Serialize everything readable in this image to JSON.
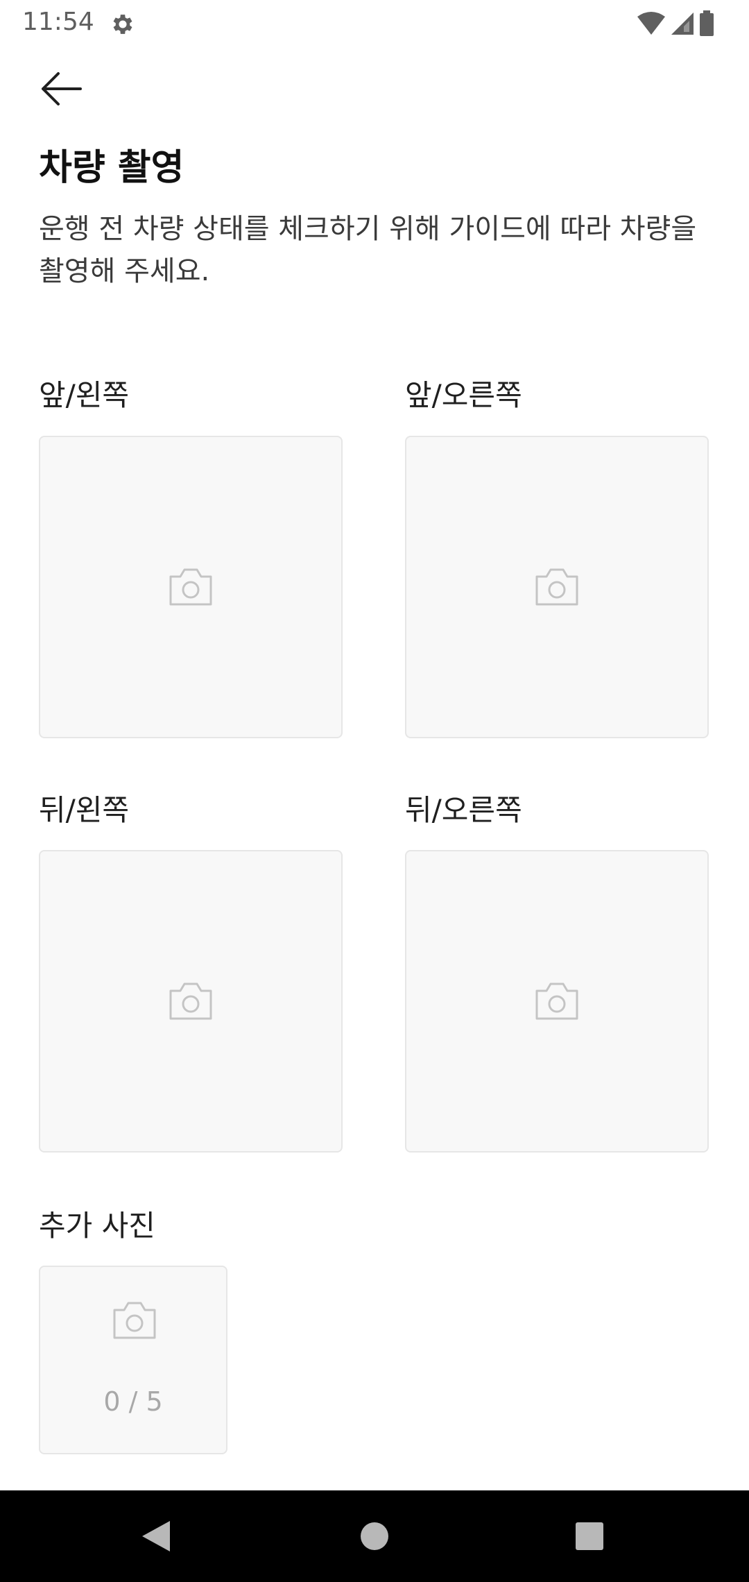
{
  "status_bar": {
    "time": "11:54",
    "icons": [
      "gear-icon",
      "wifi-icon",
      "signal-icon",
      "battery-icon"
    ]
  },
  "header": {
    "back_icon": "arrow-left-icon",
    "title": "차량 촬영",
    "description": "운행 전 차량 상태를 체크하기 위해 가이드에 따라 차량을 촬영해 주세요."
  },
  "photo_slots": [
    {
      "label": "앞/왼쪽",
      "icon": "camera-icon"
    },
    {
      "label": "앞/오른쪽",
      "icon": "camera-icon"
    },
    {
      "label": "뒤/왼쪽",
      "icon": "camera-icon"
    },
    {
      "label": "뒤/오른쪽",
      "icon": "camera-icon"
    }
  ],
  "extra_photos": {
    "label": "추가 사진",
    "count_text": "0 / 5",
    "count": 0,
    "max": 5,
    "icon": "camera-icon"
  },
  "nav_bar": {
    "buttons": [
      "back-triangle-icon",
      "home-circle-icon",
      "recents-square-icon"
    ]
  },
  "colors": {
    "slot_background": "#f8f8f8",
    "slot_border": "#e6e6e6",
    "icon_gray": "#c4c4c4",
    "count_gray": "#a8a8a8",
    "nav_background": "#000000"
  }
}
